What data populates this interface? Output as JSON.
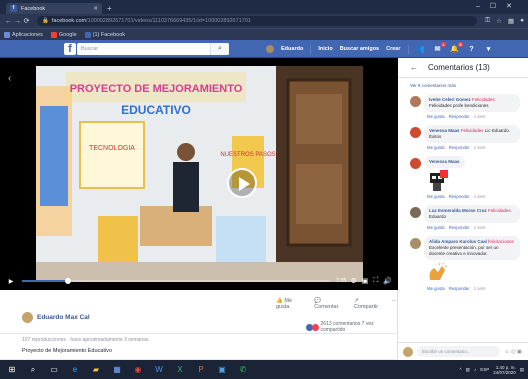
{
  "browser": {
    "tab_title": "Facebook",
    "tab_favicon": "f",
    "new_tab_icon": "+",
    "url_host": "facebook.com",
    "url_path": "/100002892671701/videos/1110376669435/1/id=100002892671701",
    "bookmarks": [
      {
        "label": "Aplicaciones",
        "icon": "apps-icon",
        "color": "#6b8bd6"
      },
      {
        "label": "Google",
        "icon": "google-icon",
        "color": "#ea4335"
      },
      {
        "label": "(1) Facebook",
        "icon": "facebook-icon",
        "color": "#4267b2"
      }
    ]
  },
  "fb": {
    "logo": "f",
    "search_placeholder": "Buscar",
    "user_name": "Eduardo",
    "nav": [
      "Inicio",
      "Buscar amigos",
      "Crear"
    ],
    "badges": {
      "messages": "1",
      "notifications": "5"
    }
  },
  "video": {
    "time": "7:35",
    "progress": 0.15,
    "scene": {
      "banner_top": "PROYECTO DE MEJORAMIENTO",
      "banner_bottom": "EDUCATIVO",
      "board_text": "TECNOLOGIA",
      "poster_text": "NUESTROS PASOS"
    }
  },
  "post": {
    "actions": [
      "Me gusta",
      "Comentar",
      "Compartir"
    ],
    "author": "Eduardo Max Cal",
    "reaction_summary": "2613 comentarios 7 vez compartido",
    "views": "107 reproducciones · hace aproximadamente 3 semanas",
    "description": "Proyecto de Mejoramiento Educativo"
  },
  "comments_panel": {
    "title": "Comentarios (13)",
    "more_link": "Ver 8 comentarios más",
    "comments": [
      {
        "name": "Ivette Celeri Gomez",
        "text": "Felicidades profe bendiciones",
        "tag": "Felicidades",
        "color": "#b07a5a",
        "time": "1 sem",
        "sticker": false
      },
      {
        "name": "Venessa Maas",
        "text": "Lic Eduardo. Éxitos",
        "tag": "Felicidades",
        "color": "#d04a2f",
        "time": "1 sem",
        "sticker": false
      },
      {
        "name": "Venessa Maas",
        "text": "",
        "tag": "",
        "color": "#d04a2f",
        "time": "1 sem",
        "sticker": true
      },
      {
        "name": "Luz Esmeralda Moran Cruz",
        "text": "Eduardo",
        "tag": "Felicidades",
        "color": "#7a6a5a",
        "time": "1 sem",
        "sticker": false
      },
      {
        "name": "Alida Amparo Karolus Caal",
        "text": "Excelente presentación, por ser un docente creativo e innovador.",
        "tag": "felicitaciones",
        "color": "#a88f6a",
        "time": "1 sem",
        "sticker": "clap"
      }
    ],
    "reply_actions": [
      "Me gusta",
      "Responder"
    ],
    "composer_placeholder": "Escribe un comentario..."
  },
  "taskbar": {
    "apps": [
      {
        "icon": "windows-icon",
        "glyph": "⊞",
        "color": "#ffffff"
      },
      {
        "icon": "search-icon",
        "glyph": "⌕",
        "color": "#ffffff"
      },
      {
        "icon": "task-view-icon",
        "glyph": "▭",
        "color": "#ffffff"
      },
      {
        "icon": "edge-icon",
        "glyph": "e",
        "color": "#3ea6ff"
      },
      {
        "icon": "file-explorer-icon",
        "glyph": "▰",
        "color": "#f5c542"
      },
      {
        "icon": "store-icon",
        "glyph": "▦",
        "color": "#7aa7ff"
      },
      {
        "icon": "chrome-icon",
        "glyph": "◉",
        "color": "#e8453c"
      },
      {
        "icon": "word-icon",
        "glyph": "W",
        "color": "#4f8ef7"
      },
      {
        "icon": "excel-icon",
        "glyph": "X",
        "color": "#35b56e"
      },
      {
        "icon": "powerpoint-icon",
        "glyph": "P",
        "color": "#e2663b"
      },
      {
        "icon": "photos-icon",
        "glyph": "▣",
        "color": "#4fa3e0"
      },
      {
        "icon": "whatsapp-icon",
        "glyph": "✆",
        "color": "#35c46b"
      }
    ],
    "lang": "ESP",
    "time": "1:40 p. m.",
    "date": "24/07/2020"
  }
}
